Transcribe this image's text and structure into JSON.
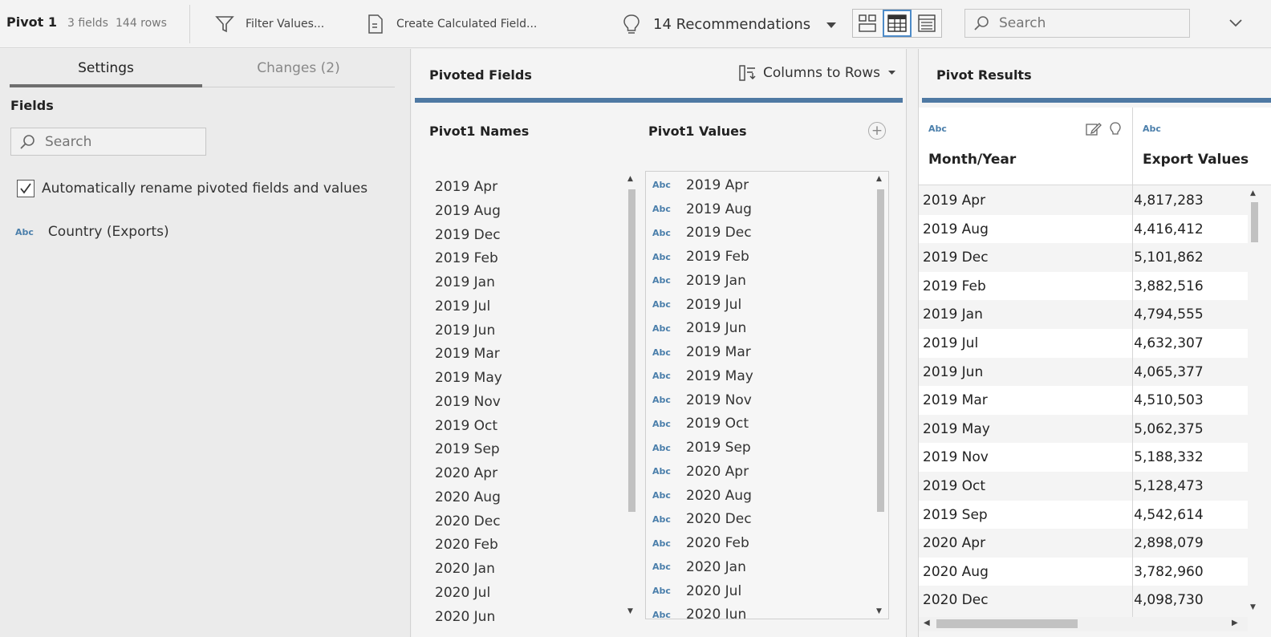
{
  "toolbar": {
    "title": "Pivot 1",
    "fields_count": "3 fields",
    "rows_count": "144 rows",
    "filter_label": "Filter Values...",
    "calc_label": "Create Calculated Field...",
    "recommendations": "14 Recommendations",
    "search_placeholder": "Search"
  },
  "settings": {
    "tabs": [
      {
        "label": "Settings",
        "active": true
      },
      {
        "label": "Changes (2)",
        "active": false
      }
    ],
    "fields_heading": "Fields",
    "search_placeholder": "Search",
    "auto_rename_label": "Automatically rename pivoted fields and values",
    "auto_rename_checked": true,
    "fields": [
      {
        "type": "Abc",
        "name": "Country (Exports)"
      }
    ]
  },
  "pivoted_fields": {
    "title": "Pivoted Fields",
    "mode": "Columns to Rows",
    "names_header": "Pivot1 Names",
    "values_header": "Pivot1 Values",
    "names": [
      "2019 Apr",
      "2019 Aug",
      "2019 Dec",
      "2019 Feb",
      "2019 Jan",
      "2019 Jul",
      "2019 Jun",
      "2019 Mar",
      "2019 May",
      "2019 Nov",
      "2019 Oct",
      "2019 Sep",
      "2020 Apr",
      "2020 Aug",
      "2020 Dec",
      "2020 Feb",
      "2020 Jan",
      "2020 Jul",
      "2020 Jun"
    ],
    "value_type": "Abc",
    "values": [
      "2019 Apr",
      "2019 Aug",
      "2019 Dec",
      "2019 Feb",
      "2019 Jan",
      "2019 Jul",
      "2019 Jun",
      "2019 Mar",
      "2019 May",
      "2019 Nov",
      "2019 Oct",
      "2019 Sep",
      "2020 Apr",
      "2020 Aug",
      "2020 Dec",
      "2020 Feb",
      "2020 Jan",
      "2020 Jul",
      "2020 Jun"
    ]
  },
  "pivot_results": {
    "title": "Pivot Results",
    "columns": [
      {
        "type": "Abc",
        "name": "Month/Year"
      },
      {
        "type": "Abc",
        "name": "Export Values"
      }
    ],
    "rows": [
      [
        "2019 Apr",
        "4,817,283"
      ],
      [
        "2019 Aug",
        "4,416,412"
      ],
      [
        "2019 Dec",
        "5,101,862"
      ],
      [
        "2019 Feb",
        "3,882,516"
      ],
      [
        "2019 Jan",
        "4,794,555"
      ],
      [
        "2019 Jul",
        "4,632,307"
      ],
      [
        "2019 Jun",
        "4,065,377"
      ],
      [
        "2019 Mar",
        "4,510,503"
      ],
      [
        "2019 May",
        "5,062,375"
      ],
      [
        "2019 Nov",
        "5,188,332"
      ],
      [
        "2019 Oct",
        "5,128,473"
      ],
      [
        "2019 Sep",
        "4,542,614"
      ],
      [
        "2020 Apr",
        "2,898,079"
      ],
      [
        "2020 Aug",
        "3,782,960"
      ],
      [
        "2020 Dec",
        "4,098,730"
      ]
    ]
  },
  "colors": {
    "accent_bar": "#4f79a3",
    "type_badge": "#4b7fab",
    "active_view": "#4d8bc8"
  }
}
